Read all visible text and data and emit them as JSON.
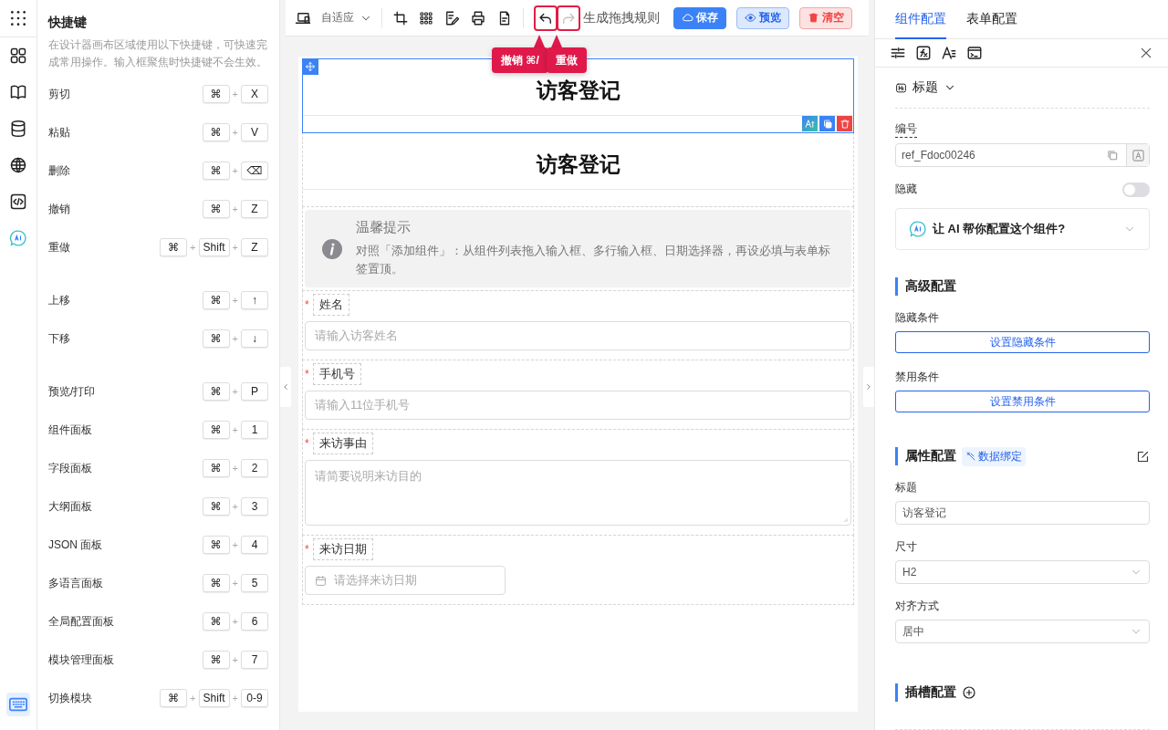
{
  "rail": [
    {
      "kind": "dots",
      "selected": false
    },
    {
      "kind": "blocks",
      "selected": false
    },
    {
      "kind": "book",
      "selected": false
    },
    {
      "kind": "database",
      "selected": false
    },
    {
      "kind": "globe",
      "selected": false
    },
    {
      "kind": "code",
      "selected": false
    },
    {
      "kind": "ai",
      "selected": false
    },
    {
      "kind": "keyboard",
      "selected": true
    }
  ],
  "shortcuts": {
    "title": "快捷键",
    "description": "在设计器画布区域使用以下快捷键，可快速完成常用操作。输入框聚焦时快捷键不会生效。",
    "groups": [
      [
        {
          "label": "剪切",
          "keys": [
            "⌘",
            "+",
            "X"
          ]
        },
        {
          "label": "粘贴",
          "keys": [
            "⌘",
            "+",
            "V"
          ]
        },
        {
          "label": "删除",
          "keys": [
            "⌘",
            "+",
            "⌫"
          ]
        },
        {
          "label": "撤销",
          "keys": [
            "⌘",
            "+",
            "Z"
          ]
        },
        {
          "label": "重做",
          "keys": [
            "⌘",
            "+",
            "Shift",
            "+",
            "Z"
          ]
        }
      ],
      [
        {
          "label": "上移",
          "keys": [
            "⌘",
            "+",
            "↑"
          ]
        },
        {
          "label": "下移",
          "keys": [
            "⌘",
            "+",
            "↓"
          ]
        }
      ],
      [
        {
          "label": "预览/打印",
          "keys": [
            "⌘",
            "+",
            "P"
          ]
        },
        {
          "label": "组件面板",
          "keys": [
            "⌘",
            "+",
            "1"
          ]
        },
        {
          "label": "字段面板",
          "keys": [
            "⌘",
            "+",
            "2"
          ]
        },
        {
          "label": "大纲面板",
          "keys": [
            "⌘",
            "+",
            "3"
          ]
        },
        {
          "label": "JSON 面板",
          "keys": [
            "⌘",
            "+",
            "4"
          ]
        },
        {
          "label": "多语言面板",
          "keys": [
            "⌘",
            "+",
            "5"
          ]
        },
        {
          "label": "全局配置面板",
          "keys": [
            "⌘",
            "+",
            "6"
          ]
        },
        {
          "label": "模块管理面板",
          "keys": [
            "⌘",
            "+",
            "7"
          ]
        },
        {
          "label": "切换模块",
          "keys": [
            "⌘",
            "+",
            "Shift",
            "+",
            "0-9"
          ]
        }
      ]
    ]
  },
  "toolbar": {
    "viewport": "自适应",
    "undo": {
      "highlighted": true,
      "disabled": false
    },
    "redo": {
      "highlighted": true,
      "disabled": true
    },
    "rule_link": "生成拖拽规则",
    "buttons": [
      {
        "kind": "primary",
        "label": "保存"
      },
      {
        "kind": "preview",
        "label": "预览"
      },
      {
        "kind": "danger",
        "label": "清空"
      }
    ],
    "tooltips": [
      "撤销 ⌘/",
      "重做"
    ]
  },
  "canvas": {
    "blocks": [
      {
        "kind": "heading",
        "text": "访客登记",
        "selected": true
      },
      {
        "kind": "heading",
        "text": "访客登记",
        "selected": false
      },
      {
        "kind": "alert",
        "title": "温馨提示",
        "text": "对照「添加组件」：从组件列表拖入输入框、多行输入框、日期选择器，再设必填与表单标签置顶。"
      },
      {
        "kind": "input",
        "label": "姓名",
        "required_mark": "*",
        "placeholder": "请输入访客姓名"
      },
      {
        "kind": "input",
        "label": "手机号",
        "required_mark": "*",
        "placeholder": "请输入11位手机号"
      },
      {
        "kind": "textarea",
        "label": "来访事由",
        "required_mark": "*",
        "placeholder": "请简要说明来访目的"
      },
      {
        "kind": "date",
        "label": "来访日期",
        "required_mark": "*",
        "placeholder": "请选择来访日期"
      }
    ]
  },
  "panel": {
    "tabs": [
      {
        "label": "组件配置",
        "selected": true
      },
      {
        "label": "表单配置",
        "selected": false
      }
    ],
    "component_type": "标题",
    "id_field": {
      "label": "编号",
      "value": "ref_Fdoc00246"
    },
    "hidden": {
      "label": "隐藏",
      "on": false
    },
    "ai_prompt": "让 AI 帮你配置这个组件?",
    "advanced": {
      "title": "高级配置",
      "conditions": [
        {
          "label": "隐藏条件",
          "button": "设置隐藏条件"
        },
        {
          "label": "禁用条件",
          "button": "设置禁用条件"
        }
      ]
    },
    "properties": {
      "title": "属性配置",
      "tag": "数据绑定",
      "fields": [
        {
          "kind": "input",
          "label": "标题",
          "value": "访客登记"
        },
        {
          "kind": "select",
          "label": "尺寸",
          "value": "H2"
        },
        {
          "kind": "select",
          "label": "对齐方式",
          "value": "居中"
        }
      ]
    },
    "slots": {
      "title": "插槽配置"
    }
  }
}
